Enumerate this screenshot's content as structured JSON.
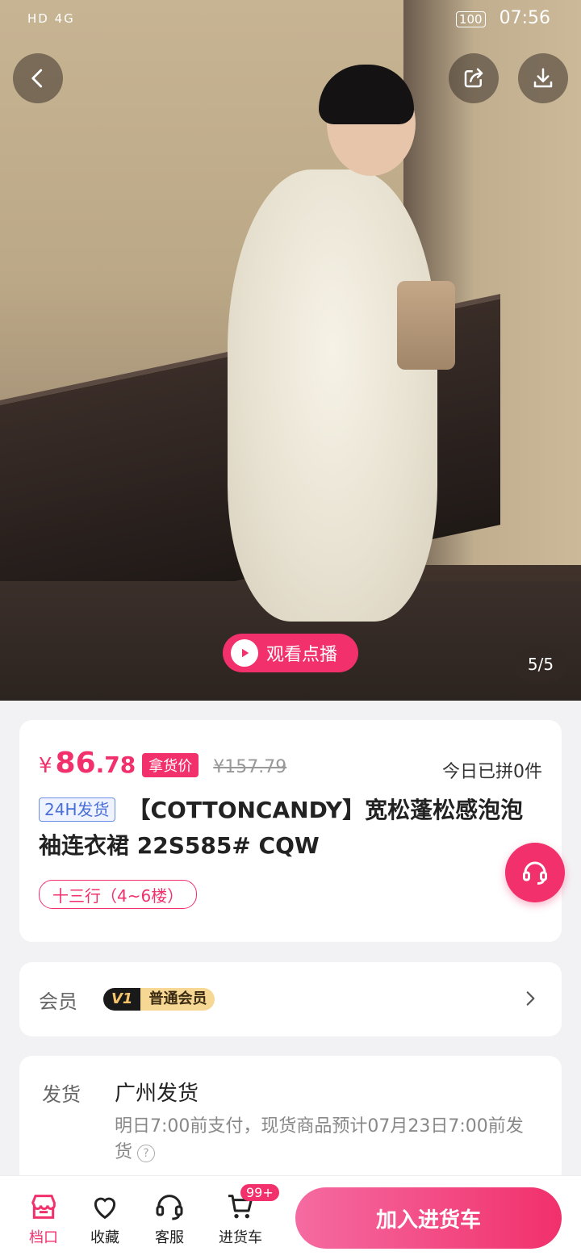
{
  "status_bar": {
    "left": "HD 4G",
    "battery": "100",
    "time": "07:56"
  },
  "hero": {
    "watch_label": "观看点播",
    "counter": "5/5"
  },
  "product": {
    "currency": "¥",
    "price_int": "86",
    "price_dec": ".78",
    "price_tag": "拿货价",
    "original_price": "¥157.79",
    "sold_today": "今日已拼0件",
    "ship_badge": "24H发货",
    "title": "【COTTONCANDY】宽松蓬松感泡泡袖连衣裙  22S585#  CQW",
    "location": "十三行（4~6楼）"
  },
  "member": {
    "label": "会员",
    "level_v": "V1",
    "level_name": "普通会员"
  },
  "shipping": {
    "label": "发货",
    "city": "广州发货",
    "note": "明日7:00前支付，现货商品预计07月23日7:00前发货",
    "help": "?"
  },
  "bottom_bar": {
    "tabs": [
      {
        "label": "档口",
        "icon": "store-icon"
      },
      {
        "label": "收藏",
        "icon": "heart-icon"
      },
      {
        "label": "客服",
        "icon": "headset-icon"
      },
      {
        "label": "进货车",
        "icon": "cart-icon"
      }
    ],
    "cart_badge": "99+",
    "add_to_cart": "加入进货车"
  },
  "colors": {
    "accent": "#f1306c",
    "badge_blue": "#4b6fd8"
  }
}
